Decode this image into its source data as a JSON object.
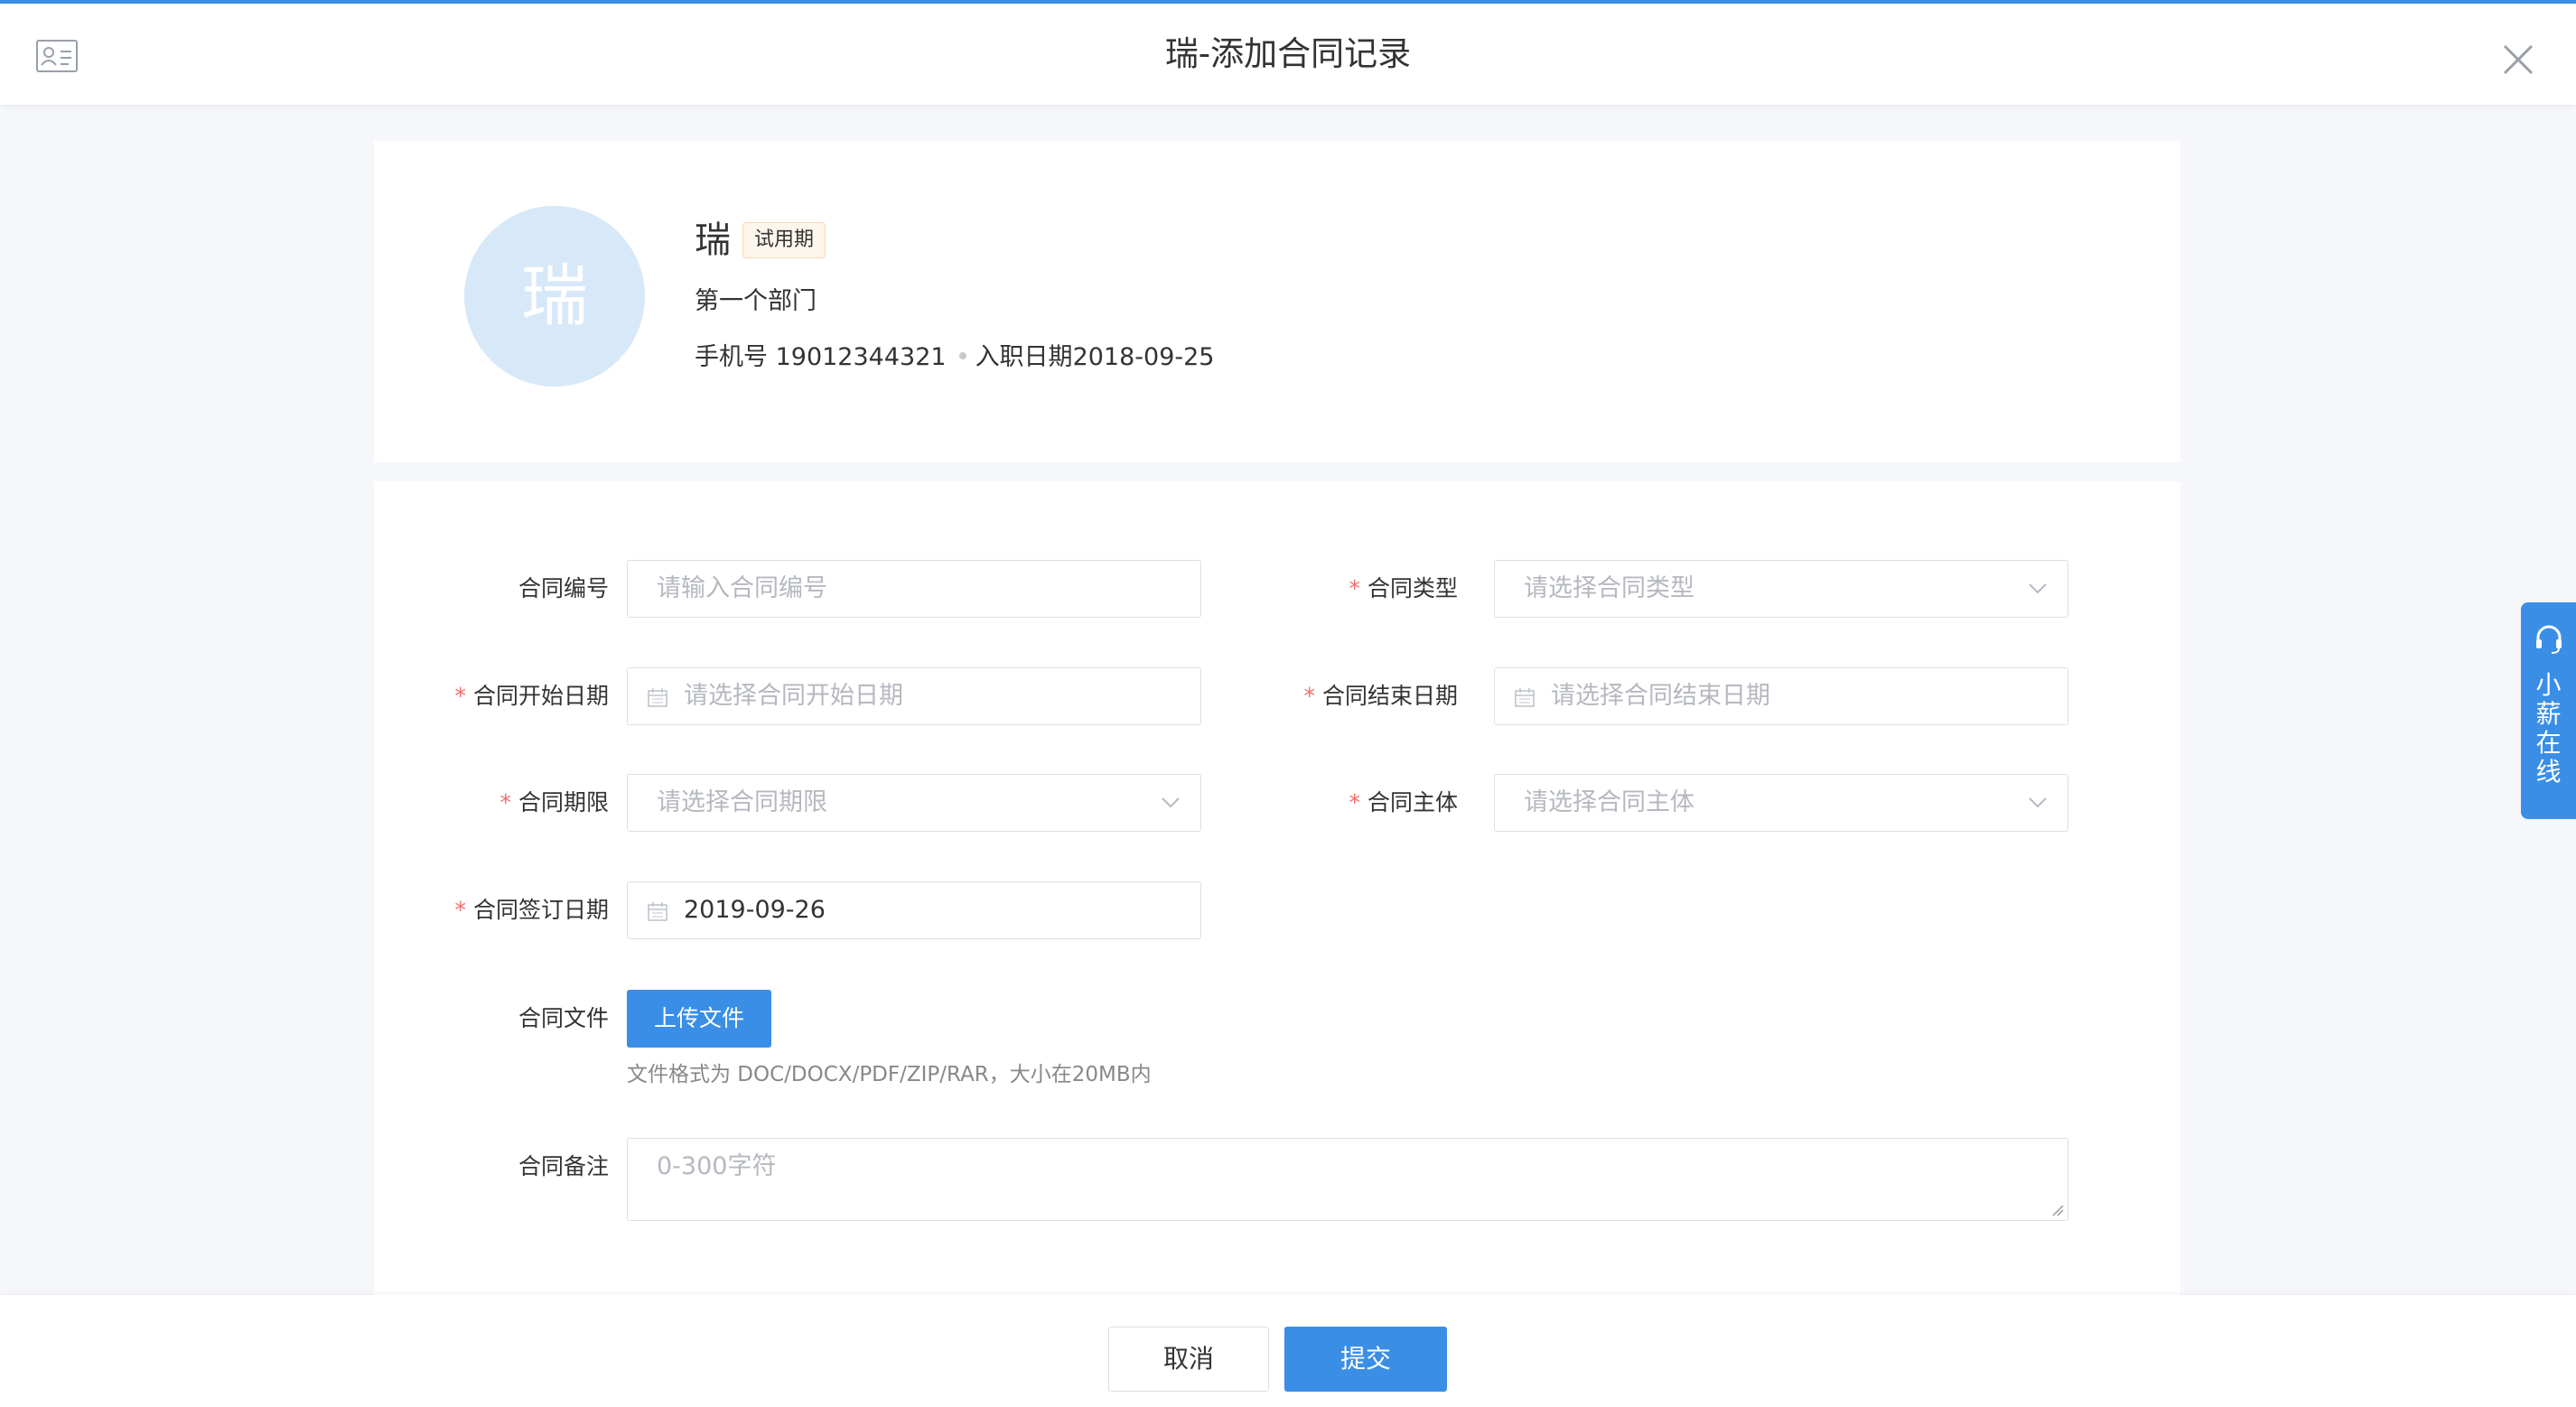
{
  "dialog": {
    "title": "瑞-添加合同记录"
  },
  "profile": {
    "avatar_text": "瑞",
    "name": "瑞",
    "status_badge": "试用期",
    "department": "第一个部门",
    "phone_label": "手机号",
    "phone": "19012344321",
    "hire_date_label": "入职日期",
    "hire_date": "2018-09-25"
  },
  "form": {
    "contract_no": {
      "label": "合同编号",
      "required": false,
      "placeholder": "请输入合同编号"
    },
    "contract_type": {
      "label": "合同类型",
      "required": true,
      "placeholder": "请选择合同类型"
    },
    "start_date": {
      "label": "合同开始日期",
      "required": true,
      "placeholder": "请选择合同开始日期"
    },
    "end_date": {
      "label": "合同结束日期",
      "required": true,
      "placeholder": "请选择合同结束日期"
    },
    "term": {
      "label": "合同期限",
      "required": true,
      "placeholder": "请选择合同期限"
    },
    "entity": {
      "label": "合同主体",
      "required": true,
      "placeholder": "请选择合同主体"
    },
    "sign_date": {
      "label": "合同签订日期",
      "required": true,
      "value": "2019-09-26"
    },
    "file": {
      "label": "合同文件",
      "button": "上传文件",
      "hint": "文件格式为 DOC/DOCX/PDF/ZIP/RAR，大小在20MB内"
    },
    "remark": {
      "label": "合同备注",
      "placeholder": "0-300字符"
    }
  },
  "footer": {
    "cancel": "取消",
    "submit": "提交"
  },
  "side_widget": {
    "chars": [
      "小",
      "薪",
      "在",
      "线"
    ]
  },
  "colors": {
    "primary": "#3a8ee6",
    "required": "#f56c6c",
    "avatar_bg": "#d7e8f8",
    "badge_bg": "#fdf6ec"
  },
  "icons": [
    "id-card-icon",
    "close-icon",
    "calendar-icon",
    "chevron-down-icon",
    "headset-icon"
  ]
}
